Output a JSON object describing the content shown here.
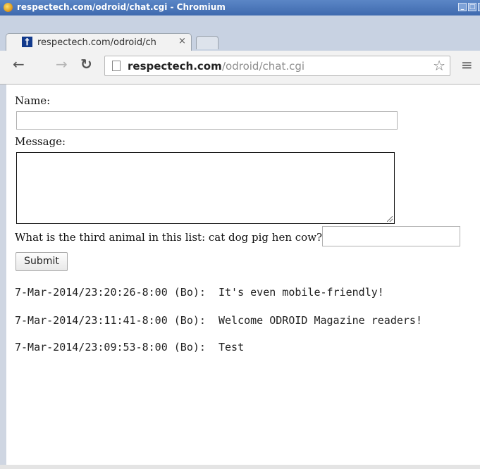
{
  "window": {
    "title": "respectech.com/odroid/chat.cgi - Chromium"
  },
  "tabs": [
    {
      "label": "respectech.com/odroid/ch",
      "close": "×",
      "favicon": "†"
    }
  ],
  "toolbar": {
    "back": "←",
    "forward": "→",
    "reload": "↻",
    "menu": "≡",
    "star": "☆"
  },
  "omnibox": {
    "host": "respectech.com",
    "path": "/odroid/chat.cgi"
  },
  "form": {
    "name_label": "Name:",
    "message_label": "Message:",
    "question": "What is the third animal in this list: cat dog pig hen cow?",
    "submit_label": "Submit"
  },
  "messages": [
    {
      "timestamp": "7-Mar-2014/23:20:26-8:00",
      "user": "(Bo):",
      "text": "It's even mobile-friendly!"
    },
    {
      "timestamp": "7-Mar-2014/23:11:41-8:00",
      "user": "(Bo):",
      "text": "Welcome ODROID Magazine readers!"
    },
    {
      "timestamp": "7-Mar-2014/23:09:53-8:00",
      "user": "(Bo):",
      "text": "Test"
    }
  ]
}
